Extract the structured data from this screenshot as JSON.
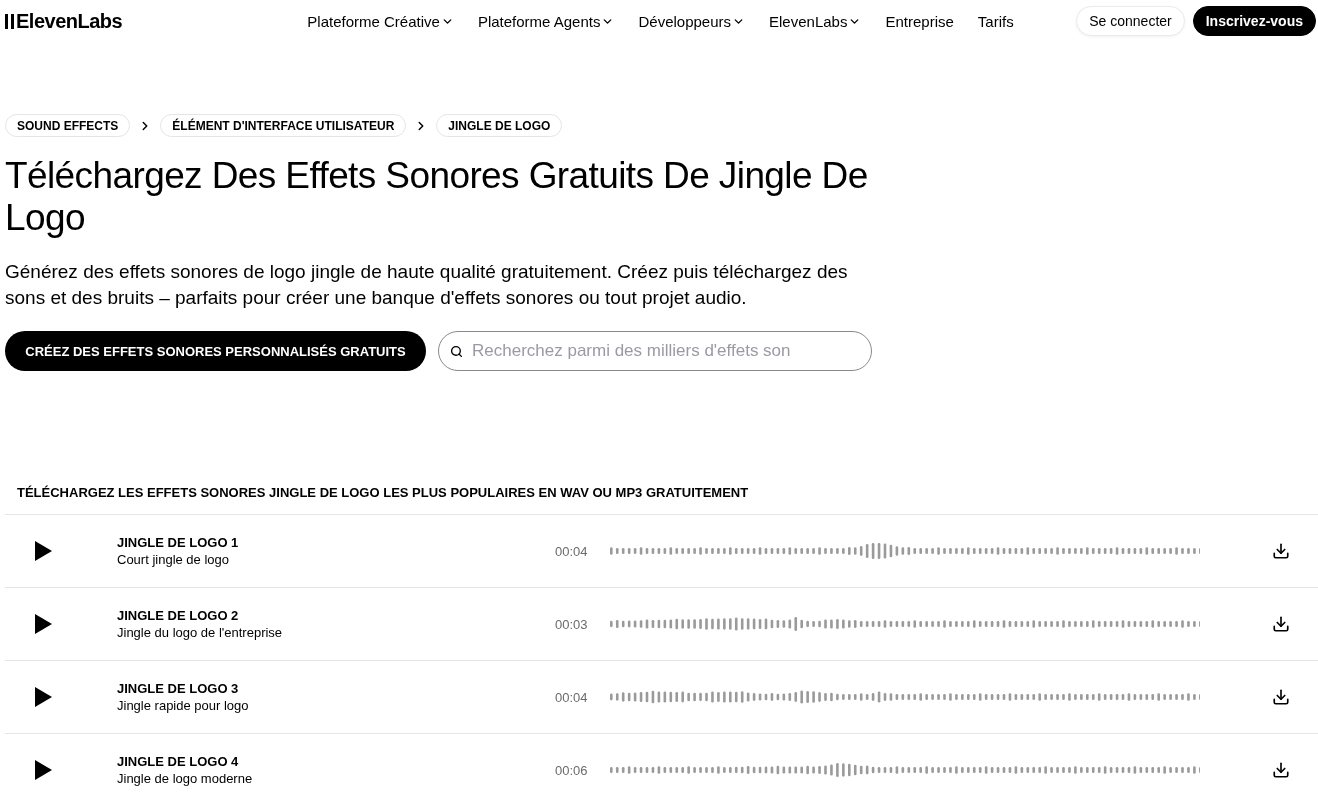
{
  "header": {
    "logo": "ElevenLabs",
    "nav": [
      {
        "label": "Plateforme Créative",
        "dropdown": true
      },
      {
        "label": "Plateforme Agents",
        "dropdown": true
      },
      {
        "label": "Développeurs",
        "dropdown": true
      },
      {
        "label": "ElevenLabs",
        "dropdown": true
      },
      {
        "label": "Entreprise",
        "dropdown": false
      },
      {
        "label": "Tarifs",
        "dropdown": false
      }
    ],
    "buttons": [
      {
        "label": "Se connecter",
        "kind": "outline"
      },
      {
        "label": "Inscrivez-vous",
        "kind": "filled"
      }
    ]
  },
  "breadcrumbs": [
    "SOUND EFFECTS",
    "ÉLÉMENT D'INTERFACE UTILISATEUR",
    "JINGLE DE LOGO"
  ],
  "title": "Téléchargez Des Effets Sonores Gratuits De Jingle De Logo",
  "description": "Générez des effets sonores de logo jingle de haute qualité gratuitement. Créez puis téléchargez des sons et des bruits – parfaits pour créer une banque d'effets sonores ou tout projet audio.",
  "cta": {
    "label": "CRÉEZ DES EFFETS SONORES PERSONNALISÉS GRATUITS"
  },
  "search": {
    "placeholder": "Recherchez parmi des milliers d'effets son"
  },
  "list": {
    "heading": "TÉLÉCHARGEZ LES EFFETS SONORES JINGLE DE LOGO LES PLUS POPULAIRES EN WAV OU MP3 GRATUITEMENT",
    "rows": [
      {
        "title": "JINGLE DE LOGO 1",
        "subtitle": "Court jingle de logo",
        "duration": "00:04"
      },
      {
        "title": "JINGLE DE LOGO 2",
        "subtitle": "Jingle du logo de l'entreprise",
        "duration": "00:03"
      },
      {
        "title": "JINGLE DE LOGO 3",
        "subtitle": "Jingle rapide pour logo",
        "duration": "00:04"
      },
      {
        "title": "JINGLE DE LOGO 4",
        "subtitle": "Jingle de logo moderne",
        "duration": "00:06"
      }
    ]
  }
}
